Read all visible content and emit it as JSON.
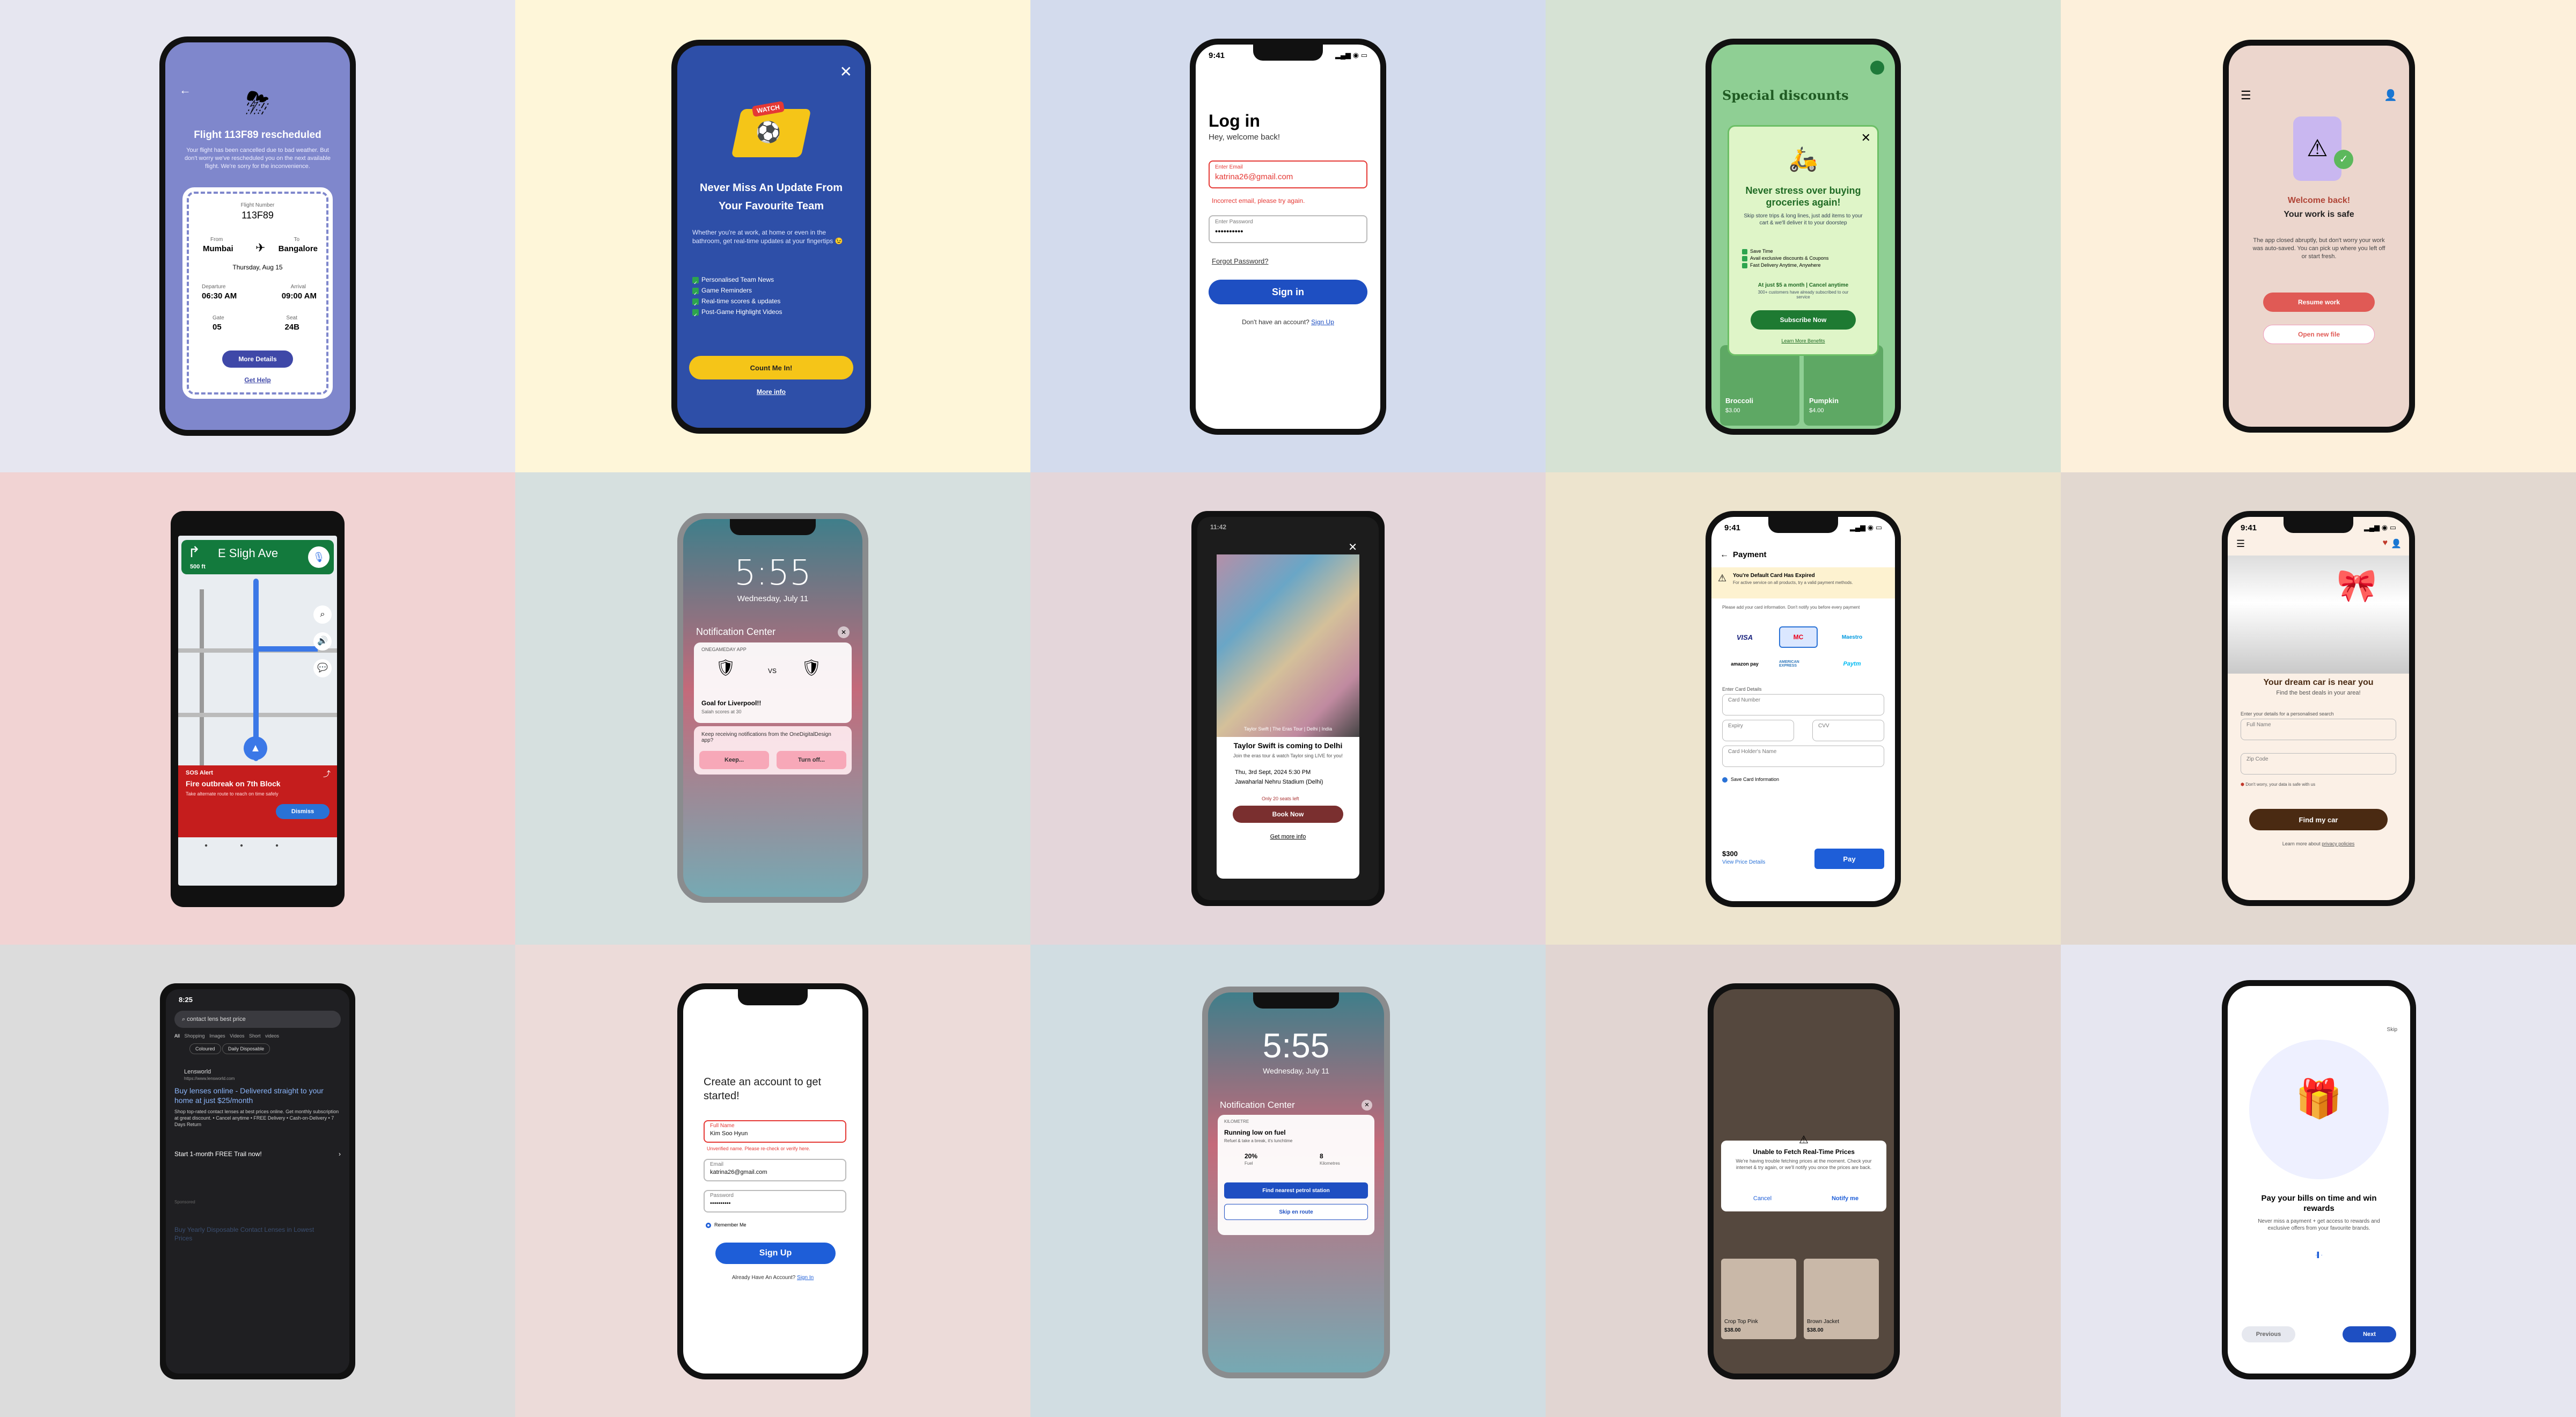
{
  "colors": {
    "bg": [
      "#e6e6f0",
      "#fef6d9",
      "#d3dbed",
      "#d6e2d4",
      "#fdf0db",
      "#f1d3d3",
      "#d6e0df",
      "#e4d6da",
      "#ede4ce",
      "#e2d8d0",
      "#dcdcdc",
      "#ecdbd9",
      "#d1dde2",
      "#e1d5d2",
      "#e6e6f0"
    ]
  },
  "s1": {
    "title": "Flight 113F89 rescheduled",
    "desc": "Your flight has been cancelled due to bad weather. But don't worry we've rescheduled you on the next available flight. We're sorry for the inconvenience.",
    "flight_label": "Flight Number",
    "flight": "113F89",
    "from_label": "From",
    "from": "Mumbai",
    "to_label": "To",
    "to": "Bangalore",
    "date": "Thursday, Aug 15",
    "dep_label": "Departure",
    "dep": "06:30 AM",
    "arr_label": "Arrival",
    "arr": "09:00 AM",
    "gate_label": "Gate",
    "gate": "05",
    "seat_label": "Seat",
    "seat": "24B",
    "more": "More Details",
    "help": "Get Help"
  },
  "s2": {
    "sticker": "WATCH",
    "title": "Never Miss An Update From Your Favourite Team",
    "desc": "Whether you're at work, at home or even in the bathroom, get real-time updates at your fingertips 😉",
    "items": [
      "Personalised Team News",
      "Game Reminders",
      "Real-time scores & updates",
      "Post-Game Highlight Videos"
    ],
    "cta": "Count Me In!",
    "more": "More info"
  },
  "s3": {
    "time": "9:41",
    "title": "Log in",
    "sub": "Hey, welcome back!",
    "email_label": "Enter Email",
    "email": "katrina26@gmail.com",
    "error": "Incorrect email, please try again.",
    "pw_label": "Enter Password",
    "pw": "••••••••••",
    "forgot": "Forgot Password?",
    "signin": "Sign in",
    "no_acc": "Don't have an account?",
    "signup": "Sign Up"
  },
  "s4": {
    "header": "Special discounts",
    "title": "Never stress over buying groceries again!",
    "desc": "Skip store trips & long lines, just add items to your cart & we'll deliver it to your doorstep",
    "perks": [
      "Save Time",
      "Avail exclusive discounts & Coupons",
      "Fast Delivery Anytime, Anywhere"
    ],
    "price": "At just $5 a month | Cancel anytime",
    "price_sub": "300+ customers have already subscribed to our service",
    "cta": "Subscribe Now",
    "learn": "Learn More Benefits",
    "items": [
      {
        "name": "Broccoli",
        "price": "$3.00"
      },
      {
        "name": "Pumpkin",
        "price": "$4.00"
      }
    ]
  },
  "s5": {
    "title1": "Welcome back!",
    "title2": "Your work is safe",
    "desc": "The app closed abruptly, but don't worry your work was auto-saved. You can pick up where you left off or start fresh.",
    "resume": "Resume work",
    "open": "Open new file"
  },
  "s6": {
    "street": "E Sligh Ave",
    "dist": "500 ft",
    "alert_label": "SOS Alert",
    "alert_title": "Fire outbreak on 7th Block",
    "alert_desc": "Take alternate route to reach on time safely",
    "dismiss": "Dismiss"
  },
  "s7": {
    "time": "5:55",
    "date": "Wednesday, July 11",
    "nc": "Notification Center",
    "app": "ONEGAMEDAY APP",
    "score": "VS",
    "goal": "Goal for Liverpool!!",
    "sub": "Salah scores at 30",
    "q": "Keep receiving notifications from the OneDigitalDesign app?",
    "keep": "Keep...",
    "off": "Turn off..."
  },
  "s8": {
    "time": "11:42",
    "caption": "Taylor Swift | The Eras Tour | Delhi | India",
    "title": "Taylor Swift is coming to Delhi",
    "desc": "Join the eras tour & watch Taylor sing LIVE for you!",
    "when": "Thu, 3rd Sept, 2024 5:30 PM",
    "where": "Jawaharlal Nehru Stadium (Delhi)",
    "left": "Only 20 seats left",
    "book": "Book Now",
    "more": "Get more info"
  },
  "s9": {
    "time": "9:41",
    "title": "Payment",
    "warn_title": "You're Default Card Has Expired",
    "warn_desc": "For active service on all products, try a valid payment methods.",
    "add": "Please add your card information. Don't notify you before every payment",
    "cards": [
      "VISA",
      "MC",
      "Maestro",
      "amazon pay",
      "AMERICAN EXPRESS",
      "Paytm"
    ],
    "enter": "Enter Card Details",
    "num": "Card Number",
    "exp": "Expiry",
    "cvv": "CVV",
    "holder": "Card Holder's Name",
    "save": "Save Card Information",
    "amount": "$300",
    "details": "View Price Details",
    "pay": "Pay"
  },
  "s10": {
    "time": "9:41",
    "title": "Your dream car is near you",
    "sub": "Find the best deals in your area!",
    "prompt": "Enter your details for a personalised search",
    "name": "Full Name",
    "zip": "Zip Code",
    "privacy": "Don't worry, your data is safe with us",
    "cta": "Find my car",
    "learn": "Learn more about",
    "link": "privacy policies"
  },
  "s11": {
    "time": "8:25",
    "query": "contact lens best price",
    "tabs": [
      "All",
      "Shopping",
      "Images",
      "Videos",
      "Short videos"
    ],
    "chips": [
      "Coloured",
      "Daily Disposable"
    ],
    "site": "Lensworld",
    "url": "https://www.lensworld.com",
    "headline": "Buy lenses online - Delivered straight to your home at just $25/month",
    "body": "Shop top-rated contact lenses at best prices online. Get monthly subscription at great discount. • Cancel anytime • FREE Delivery • Cash-on-Delivery • 7 Days Return",
    "trial": "Start 1-month FREE Trail now!",
    "spons": "Sponsored",
    "ad2": "Buy Yearly Disposable Contact Lenses in Lowest Prices"
  },
  "s12": {
    "title": "Create an account to get started!",
    "name_label": "Full Name",
    "name": "Kim Soo Hyun",
    "name_err": "Unverified name. Please re-check or verify here.",
    "email_label": "Email",
    "email": "katrina26@gmail.com",
    "pw_label": "Password",
    "pw": "••••••••••",
    "remember": "Remember Me",
    "cta": "Sign Up",
    "have": "Already Have An Account?",
    "signin": "Sign In"
  },
  "s13": {
    "time": "5:55",
    "date": "Wednesday, July 11",
    "nc": "Notification Center",
    "app": "KILOMETRE",
    "title": "Running low on fuel",
    "desc": "Refuel & take a break, it's lunchtime",
    "stat1": "20%",
    "stat1l": "Fuel",
    "stat2": "8",
    "stat2l": "Kilometres",
    "find": "Find nearest petrol station",
    "skip": "Skip en route"
  },
  "s14": {
    "title": "Unable to Fetch Real-Time Prices",
    "desc": "We're having trouble fetching prices at the moment. Check your internet & try again, or we'll notify you once the prices are back.",
    "cancel": "Cancel",
    "notify": "Notify me",
    "items": [
      {
        "name": "Crop Top Pink",
        "price": "$38.00"
      },
      {
        "name": "Brown Jacket",
        "price": "$38.00"
      }
    ]
  },
  "s15": {
    "skip": "Skip",
    "title": "Pay your bills on time and win rewards",
    "desc": "Never miss a payment + get access to rewards and exclusive offers from your favourite brands.",
    "prev": "Previous",
    "next": "Next"
  }
}
